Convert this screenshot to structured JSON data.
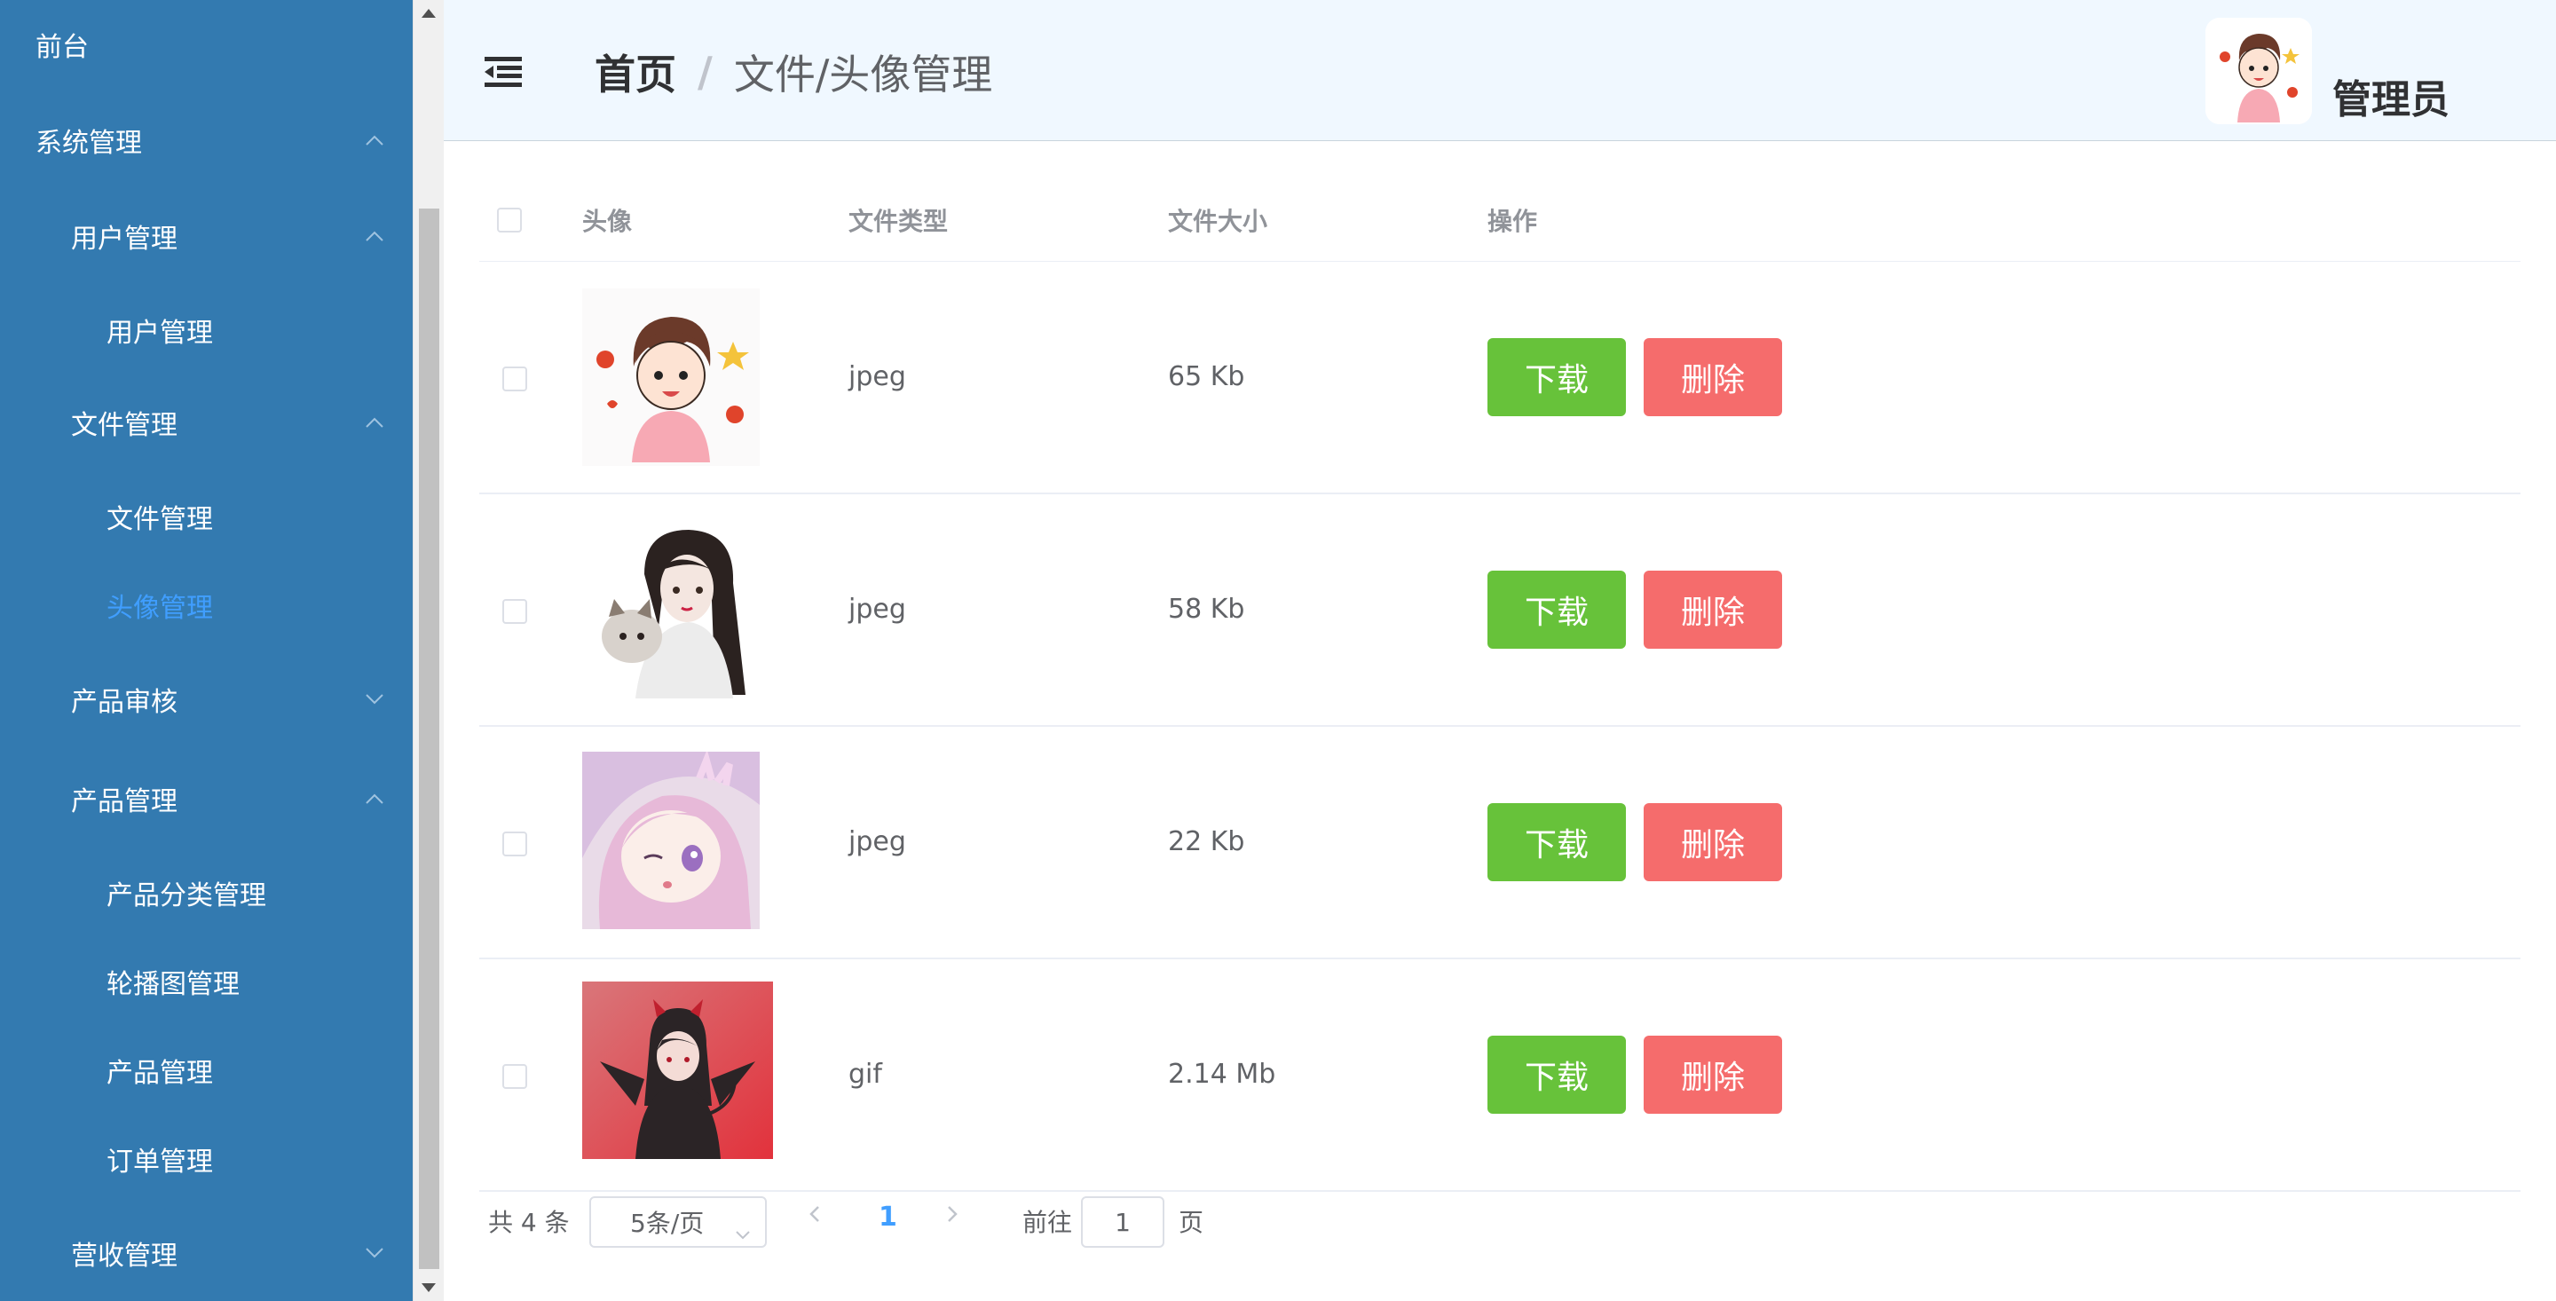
{
  "sidebar": {
    "items": [
      {
        "label": "前台",
        "level": 0,
        "chevron": "none",
        "active": false
      },
      {
        "label": "系统管理",
        "level": 0,
        "chevron": "up",
        "active": false
      },
      {
        "label": "用户管理",
        "level": 1,
        "chevron": "up",
        "active": false
      },
      {
        "label": "用户管理",
        "level": 2,
        "chevron": "none",
        "active": false
      },
      {
        "label": "文件管理",
        "level": 1,
        "chevron": "up",
        "active": false
      },
      {
        "label": "文件管理",
        "level": 2,
        "chevron": "none",
        "active": false
      },
      {
        "label": "头像管理",
        "level": 2,
        "chevron": "none",
        "active": true
      },
      {
        "label": "产品审核",
        "level": 1,
        "chevron": "down",
        "active": false
      },
      {
        "label": "产品管理",
        "level": 1,
        "chevron": "up",
        "active": false
      },
      {
        "label": "产品分类管理",
        "level": 2,
        "chevron": "none",
        "active": false
      },
      {
        "label": "轮播图管理",
        "level": 2,
        "chevron": "none",
        "active": false
      },
      {
        "label": "产品管理",
        "level": 2,
        "chevron": "none",
        "active": false
      },
      {
        "label": "订单管理",
        "level": 2,
        "chevron": "none",
        "active": false
      },
      {
        "label": "营收管理",
        "level": 1,
        "chevron": "down",
        "active": false
      }
    ],
    "bg_color": "#337ab0",
    "active_color": "#409eff"
  },
  "header": {
    "breadcrumb_home": "首页",
    "breadcrumb_sep": "/",
    "breadcrumb_current": "文件/头像管理",
    "user_name": "管理员",
    "menu_icon": "menu-fold-icon",
    "bg_color": "#f0f8ff"
  },
  "table": {
    "columns": {
      "avatar": "头像",
      "file_type": "文件类型",
      "file_size": "文件大小",
      "actions": "操作"
    },
    "rows": [
      {
        "avatar": "cartoon-boy-avatar",
        "file_type": "jpeg",
        "file_size": "65 Kb"
      },
      {
        "avatar": "girl-with-cat-avatar",
        "file_type": "jpeg",
        "file_size": "58 Kb"
      },
      {
        "avatar": "anime-pink-hair-avatar",
        "file_type": "jpeg",
        "file_size": "22 Kb"
      },
      {
        "avatar": "devil-girl-avatar",
        "file_type": "gif",
        "file_size": "2.14 Mb"
      }
    ],
    "download_label": "下载",
    "delete_label": "删除",
    "download_color": "#67c23a",
    "delete_color": "#f56c6c"
  },
  "pagination": {
    "total": "共 4 条",
    "page_size": "5条/页",
    "current_page": "1",
    "goto_prefix": "前往",
    "goto_value": "1",
    "goto_suffix": "页"
  }
}
